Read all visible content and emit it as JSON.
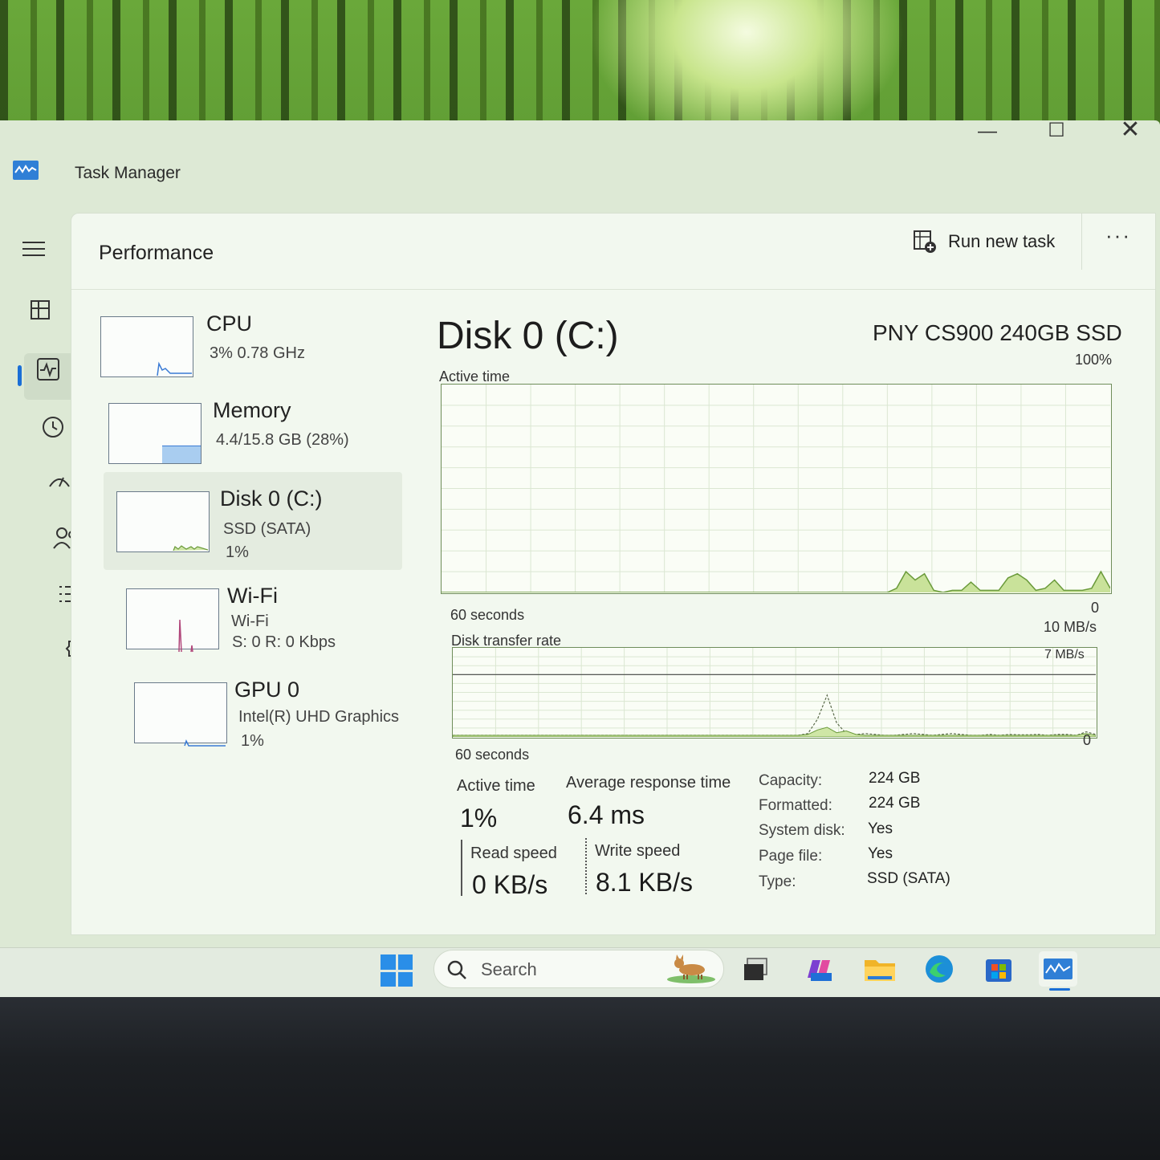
{
  "window": {
    "title": "Task Manager",
    "controls": {
      "minimize": "—",
      "maximize": "☐",
      "close": "✕"
    }
  },
  "nav": {
    "items": [
      {
        "name": "menu-icon"
      },
      {
        "name": "processes-icon"
      },
      {
        "name": "performance-icon",
        "active": true
      },
      {
        "name": "app-history-icon"
      },
      {
        "name": "startup-apps-icon"
      },
      {
        "name": "users-icon"
      },
      {
        "name": "details-icon"
      },
      {
        "name": "services-icon"
      }
    ],
    "settings_icon": "gear-icon"
  },
  "header": {
    "title": "Performance",
    "run_task": "Run new task",
    "more": "···"
  },
  "devices": [
    {
      "name": "CPU",
      "sub1": "3%  0.78 GHz",
      "sub2": "",
      "sub3": ""
    },
    {
      "name": "Memory",
      "sub1": "4.4/15.8 GB (28%)",
      "sub2": "",
      "sub3": ""
    },
    {
      "name": "Disk 0 (C:)",
      "sub1": "SSD (SATA)",
      "sub2": "1%",
      "sub3": ""
    },
    {
      "name": "Wi-Fi",
      "sub1": "Wi-Fi",
      "sub2": "S: 0  R: 0 Kbps",
      "sub3": ""
    },
    {
      "name": "GPU 0",
      "sub1": "Intel(R) UHD Graphics",
      "sub2": "1%",
      "sub3": ""
    }
  ],
  "detail": {
    "title": "Disk 0 (C:)",
    "model": "PNY CS900 240GB SSD",
    "active_chart": {
      "label": "Active time",
      "max_label": "100%",
      "min_label": "0",
      "time_label": "60 seconds"
    },
    "transfer_chart": {
      "label": "Disk transfer rate",
      "max_label": "10 MB/s",
      "line_label": "7 MB/s",
      "min_label": "0",
      "time_label": "60 seconds"
    },
    "stats": {
      "active_time_label": "Active time",
      "active_time_value": "1%",
      "avg_resp_label": "Average response time",
      "avg_resp_value": "6.4 ms",
      "read_label": "Read speed",
      "read_value": "0 KB/s",
      "write_label": "Write speed",
      "write_value": "8.1 KB/s"
    },
    "properties": [
      {
        "k": "Capacity:",
        "v": "224 GB"
      },
      {
        "k": "Formatted:",
        "v": "224 GB"
      },
      {
        "k": "System disk:",
        "v": "Yes"
      },
      {
        "k": "Page file:",
        "v": "Yes"
      },
      {
        "k": "Type:",
        "v": "SSD (SATA)"
      }
    ]
  },
  "taskbar": {
    "search_placeholder": "Search",
    "apps": [
      "start",
      "task-view",
      "copilot",
      "file-explorer",
      "edge",
      "microsoft-store",
      "task-manager"
    ]
  },
  "chart_data": [
    {
      "type": "area",
      "title": "Active time",
      "ylim": [
        0,
        100
      ],
      "x_span": "60 seconds",
      "values": [
        0,
        0,
        0,
        0,
        0,
        0,
        0,
        0,
        0,
        0,
        0,
        0,
        0,
        0,
        0,
        0,
        0,
        0,
        0,
        0,
        0,
        0,
        0,
        0,
        0,
        0,
        0,
        0,
        0,
        0,
        0,
        0,
        0,
        0,
        0,
        0,
        0,
        0,
        0,
        0,
        0,
        0,
        0,
        0,
        0,
        0,
        0,
        0,
        0,
        2,
        10,
        6,
        9,
        1,
        0,
        1,
        1,
        5,
        1,
        1,
        1,
        7,
        9,
        6,
        1,
        2,
        6,
        1,
        1,
        1,
        2,
        10,
        2
      ]
    },
    {
      "type": "line",
      "title": "Disk transfer rate",
      "ylim": [
        0,
        10
      ],
      "y_unit": "MB/s",
      "reference_line": 7,
      "x_span": "60 seconds",
      "series": [
        {
          "values": [
            0,
            0,
            0,
            0,
            0,
            0,
            0,
            0,
            0,
            0,
            0,
            0,
            0,
            0,
            0,
            0,
            0,
            0,
            0,
            0,
            0,
            0,
            0,
            0,
            0,
            0,
            0,
            0,
            0,
            0,
            0,
            0,
            0,
            0,
            0,
            0,
            0,
            0.2,
            1.8,
            4.5,
            1.4,
            0.2,
            0.1,
            0.2,
            0.1,
            0,
            0,
            0.1,
            0.2,
            0.1,
            0,
            0.1,
            0.2,
            0.1,
            0,
            0,
            0.1,
            0,
            0.1,
            0.05,
            0.05,
            0.1,
            0,
            0.1,
            0.1,
            0,
            0.4,
            0.1
          ]
        },
        {
          "values": [
            0,
            0,
            0,
            0,
            0,
            0,
            0,
            0,
            0,
            0,
            0,
            0,
            0,
            0,
            0,
            0,
            0,
            0,
            0,
            0,
            0,
            0,
            0,
            0,
            0,
            0,
            0,
            0,
            0,
            0,
            0,
            0,
            0,
            0,
            0,
            0,
            0,
            0.1,
            0.6,
            0.9,
            0.3,
            0.5,
            0.1,
            0,
            0,
            0,
            0,
            0,
            0,
            0,
            0,
            0,
            0,
            0,
            0,
            0,
            0,
            0,
            0,
            0,
            0,
            0,
            0,
            0,
            0,
            0,
            0.2,
            0
          ]
        }
      ]
    }
  ]
}
